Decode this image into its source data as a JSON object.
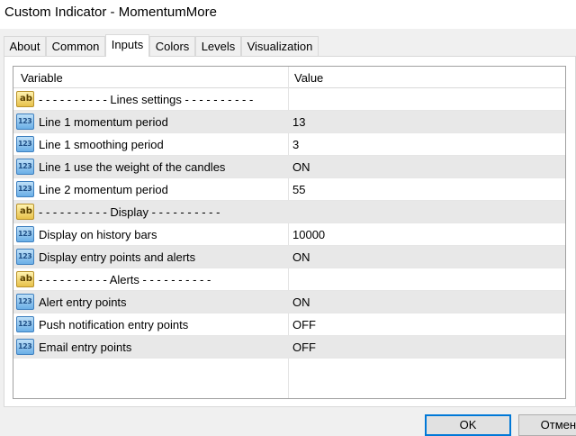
{
  "window": {
    "title": "Custom Indicator - MomentumMore"
  },
  "tabs": [
    {
      "label": "About",
      "active": false
    },
    {
      "label": "Common",
      "active": false
    },
    {
      "label": "Inputs",
      "active": true
    },
    {
      "label": "Colors",
      "active": false
    },
    {
      "label": "Levels",
      "active": false
    },
    {
      "label": "Visualization",
      "active": false
    }
  ],
  "grid": {
    "columns": {
      "variable": "Variable",
      "value": "Value"
    },
    "rows": [
      {
        "icon": "string-type-icon",
        "icon_text": "ab",
        "name": "- - - - - - - - - - Lines settings - - - - - - - - - -",
        "value": ""
      },
      {
        "icon": "number-type-icon",
        "icon_text": "123",
        "name": "Line 1 momentum period",
        "value": "13"
      },
      {
        "icon": "number-type-icon",
        "icon_text": "123",
        "name": "Line 1 smoothing period",
        "value": "3"
      },
      {
        "icon": "number-type-icon",
        "icon_text": "123",
        "name": "Line 1 use the weight of the candles",
        "value": "ON"
      },
      {
        "icon": "number-type-icon",
        "icon_text": "123",
        "name": "Line 2 momentum period",
        "value": "55"
      },
      {
        "icon": "string-type-icon",
        "icon_text": "ab",
        "name": "- - - - - - - - - - Display - - - - - - - - - -",
        "value": ""
      },
      {
        "icon": "number-type-icon",
        "icon_text": "123",
        "name": "Display on history bars",
        "value": "10000"
      },
      {
        "icon": "number-type-icon",
        "icon_text": "123",
        "name": "Display entry points and alerts",
        "value": "ON"
      },
      {
        "icon": "string-type-icon",
        "icon_text": "ab",
        "name": "- - - - - - - - - - Alerts - - - - - - - - - -",
        "value": ""
      },
      {
        "icon": "number-type-icon",
        "icon_text": "123",
        "name": "Alert entry points",
        "value": "ON"
      },
      {
        "icon": "number-type-icon",
        "icon_text": "123",
        "name": "Push notification entry points",
        "value": "OFF"
      },
      {
        "icon": "number-type-icon",
        "icon_text": "123",
        "name": "Email entry points",
        "value": "OFF"
      }
    ]
  },
  "buttons": {
    "ok": "OK",
    "cancel": "Отмена"
  }
}
